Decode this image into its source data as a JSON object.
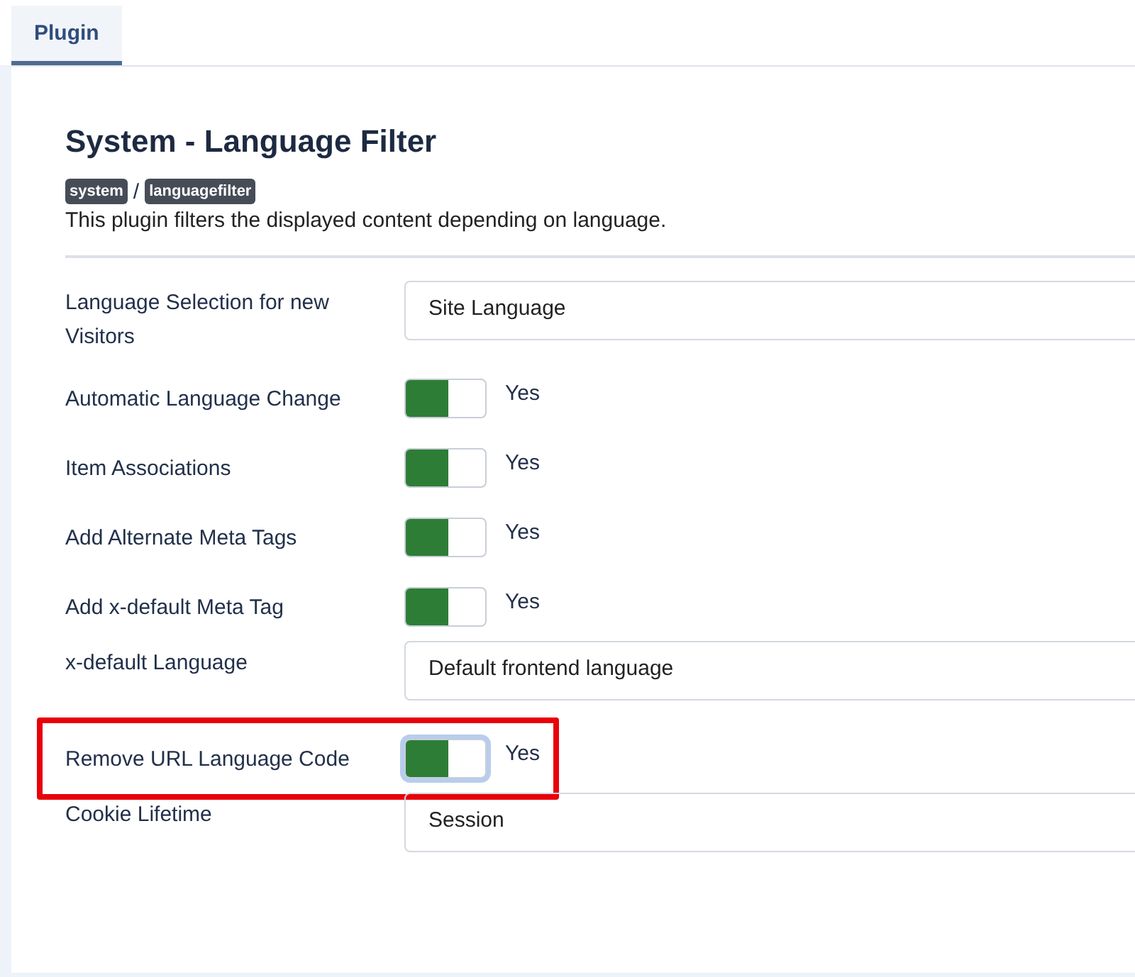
{
  "tabs": [
    {
      "label": "Plugin",
      "selected": true
    }
  ],
  "plugin": {
    "title": "System - Language Filter",
    "badges": [
      "system",
      "languagefilter"
    ],
    "separator": "/",
    "description": "This plugin filters the displayed content depending on language."
  },
  "fields": [
    {
      "kind": "select",
      "label": "Language Selection for new Visitors",
      "value": "Site Language",
      "highlighted": false
    },
    {
      "kind": "toggle",
      "label": "Automatic Language Change",
      "on": true,
      "value": "Yes",
      "highlighted": false
    },
    {
      "kind": "toggle",
      "label": "Item Associations",
      "on": true,
      "value": "Yes",
      "highlighted": false
    },
    {
      "kind": "toggle",
      "label": "Add Alternate Meta Tags",
      "on": true,
      "value": "Yes",
      "highlighted": false
    },
    {
      "kind": "toggle",
      "label": "Add x-default Meta Tag",
      "on": true,
      "value": "Yes",
      "highlighted": false
    },
    {
      "kind": "select",
      "label": "x-default Language",
      "value": "Default frontend language",
      "highlighted": false
    },
    {
      "kind": "toggle",
      "label": "Remove URL Language Code",
      "on": true,
      "value": "Yes",
      "highlighted": true
    },
    {
      "kind": "select",
      "label": "Cookie Lifetime",
      "value": "Session",
      "highlighted": false
    }
  ]
}
